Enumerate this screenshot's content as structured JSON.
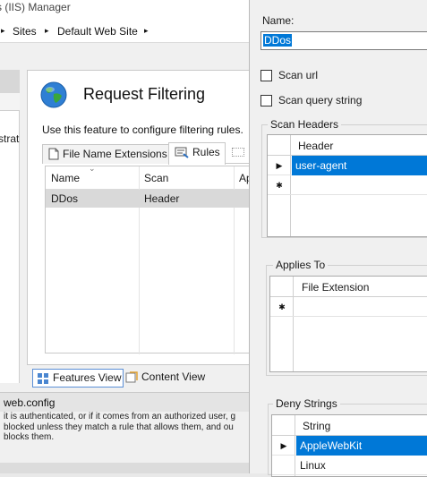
{
  "window": {
    "title": "s (IIS) Manager"
  },
  "breadcrumb": {
    "sep": "▸",
    "items": [
      "Sites",
      "Default Web Site"
    ]
  },
  "left_pane": {
    "text": "strat"
  },
  "feature": {
    "title": "Request Filtering",
    "description": "Use this feature to configure filtering rules.",
    "tabs": [
      {
        "label": "File Name Extensions"
      },
      {
        "label": "Rules"
      }
    ],
    "grid": {
      "columns": [
        "Name",
        "Scan",
        "Ap"
      ],
      "rows": [
        {
          "name": "DDos",
          "scan": "Header"
        }
      ]
    }
  },
  "views": {
    "features": "Features View",
    "content": "Content View"
  },
  "config": {
    "label": "web.config",
    "info": [
      "it is authenticated, or if it comes from an authorized user, g",
      "blocked unless they match a rule that allows them, and ou",
      "blocks them."
    ]
  },
  "dialog": {
    "name_label": "Name:",
    "name_value": "DDos",
    "scan_url": "Scan url",
    "scan_query": "Scan query string",
    "scan_headers": {
      "title": "Scan Headers",
      "column": "Header",
      "rows": [
        "user-agent"
      ]
    },
    "applies_to": {
      "title": "Applies To",
      "column": "File Extension"
    },
    "deny_strings": {
      "title": "Deny Strings",
      "column": "String",
      "rows": [
        "AppleWebKit",
        "Linux"
      ]
    },
    "markers": {
      "current": "▶",
      "new": "✱"
    }
  },
  "colors": {
    "selection": "#0078d7",
    "accent_border": "#5b8fd6"
  }
}
